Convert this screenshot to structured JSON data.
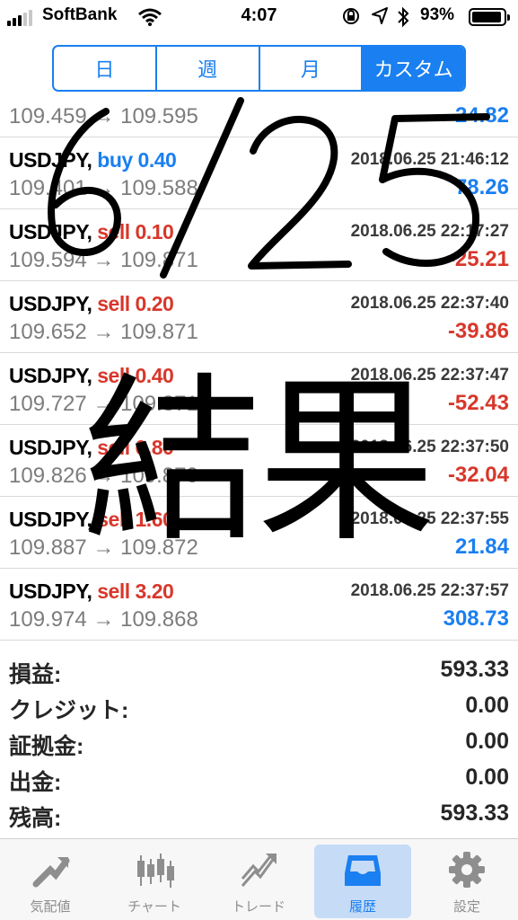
{
  "status_bar": {
    "carrier": "SoftBank",
    "time": "4:07",
    "battery": "93%"
  },
  "period_tabs": [
    {
      "label": "日",
      "active": false
    },
    {
      "label": "週",
      "active": false
    },
    {
      "label": "月",
      "active": false
    },
    {
      "label": "カスタム",
      "active": true
    }
  ],
  "deals": [
    {
      "symbol": "",
      "type": "",
      "side": "",
      "time": "",
      "price": "109.459 → 109.595",
      "profit": "24.82",
      "sign": "pos"
    },
    {
      "symbol": "USDJPY,",
      "type": "buy 0.40",
      "side": "buy",
      "time": "2018.06.25 21:46:12",
      "price": "109.401 → 109.588",
      "profit": "78.26",
      "sign": "pos"
    },
    {
      "symbol": "USDJPY,",
      "type": "sell 0.10",
      "side": "sell",
      "time": "2018.06.25 22:17:27",
      "price": "109.594 → 109.871",
      "profit": "-25.21",
      "sign": "neg"
    },
    {
      "symbol": "USDJPY,",
      "type": "sell 0.20",
      "side": "sell",
      "time": "2018.06.25 22:37:40",
      "price": "109.652 → 109.871",
      "profit": "-39.86",
      "sign": "neg"
    },
    {
      "symbol": "USDJPY,",
      "type": "sell 0.40",
      "side": "sell",
      "time": "2018.06.25 22:37:47",
      "price": "109.727 → 109.871",
      "profit": "-52.43",
      "sign": "neg"
    },
    {
      "symbol": "USDJPY,",
      "type": "sell 0.80",
      "side": "sell",
      "time": "2018.06.25 22:37:50",
      "price": "109.826 → 109.870",
      "profit": "-32.04",
      "sign": "neg"
    },
    {
      "symbol": "USDJPY,",
      "type": "sell 1.60",
      "side": "sell",
      "time": "2018.06.25 22:37:55",
      "price": "109.887 → 109.872",
      "profit": "21.84",
      "sign": "pos"
    },
    {
      "symbol": "USDJPY,",
      "type": "sell 3.20",
      "side": "sell",
      "time": "2018.06.25 22:37:57",
      "price": "109.974 → 109.868",
      "profit": "308.73",
      "sign": "pos"
    }
  ],
  "summary": [
    {
      "label": "損益:",
      "value": "593.33"
    },
    {
      "label": "クレジット:",
      "value": "0.00"
    },
    {
      "label": "証拠金:",
      "value": "0.00"
    },
    {
      "label": "出金:",
      "value": "0.00"
    },
    {
      "label": "残高:",
      "value": "593.33"
    }
  ],
  "tabs": [
    {
      "label": "気配値",
      "icon": "quotes-icon",
      "active": false
    },
    {
      "label": "チャート",
      "icon": "chart-icon",
      "active": false
    },
    {
      "label": "トレード",
      "icon": "trade-icon",
      "active": false
    },
    {
      "label": "履歴",
      "icon": "history-icon",
      "active": true
    },
    {
      "label": "設定",
      "icon": "settings-icon",
      "active": false
    }
  ],
  "overlay": {
    "date": "6/25",
    "caption": "結果"
  },
  "colors": {
    "accent": "#1a7ff0",
    "sell": "#d8372b",
    "profit_negative": "#d8372b",
    "profit_positive": "#1a7ff0"
  }
}
